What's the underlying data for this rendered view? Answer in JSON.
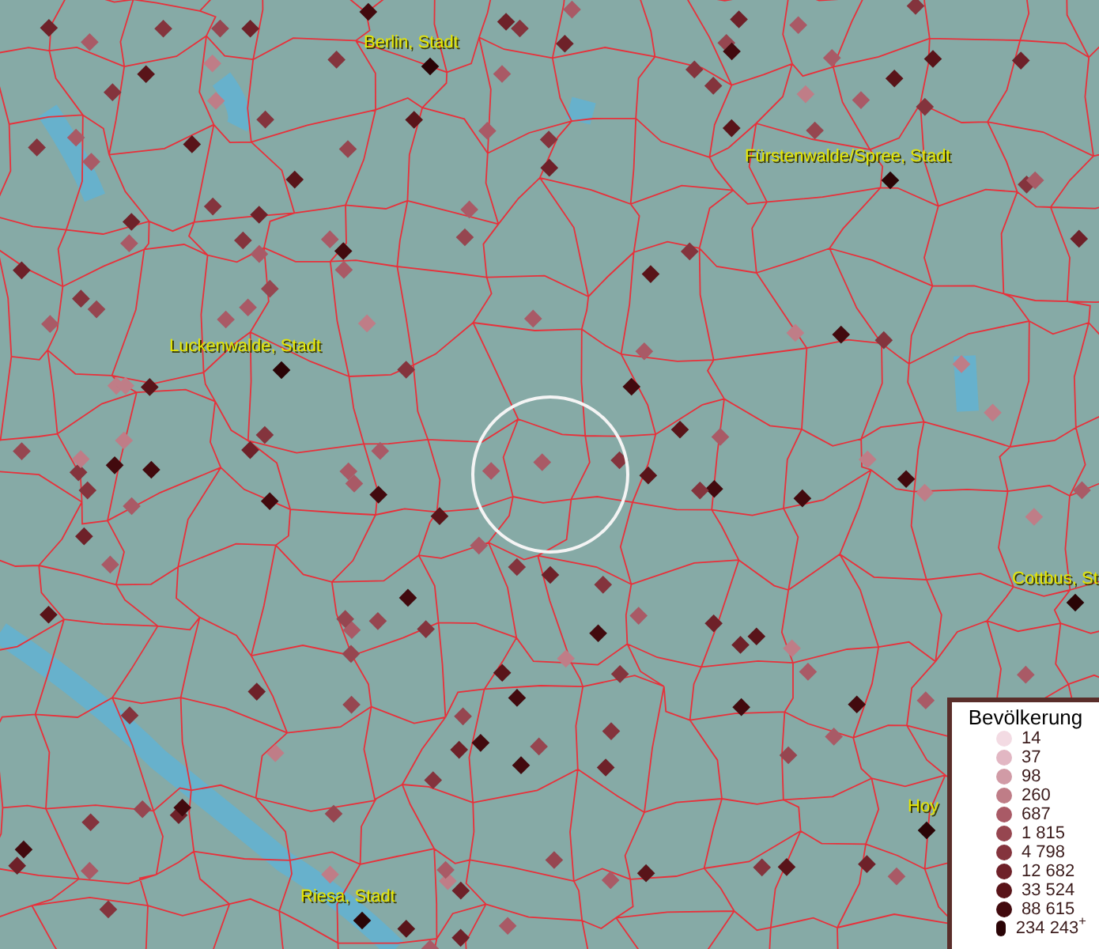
{
  "map": {
    "cities": [
      {
        "name": "Berlin, Stadt"
      },
      {
        "name": "Fürstenwalde/Spree, Stadt"
      },
      {
        "name": "Luckenwalde, Stadt"
      },
      {
        "name": "Cottbus, St"
      },
      {
        "name": "Hoy"
      },
      {
        "name": "Riesa, Stadt"
      }
    ]
  },
  "legend": {
    "title": "Bevölkerung",
    "items": [
      {
        "label": "14",
        "color": "#f3dbe3"
      },
      {
        "label": "37",
        "color": "#e2b7c3"
      },
      {
        "label": "98",
        "color": "#d19ba6"
      },
      {
        "label": "260",
        "color": "#bf7d87"
      },
      {
        "label": "687",
        "color": "#a95a66"
      },
      {
        "label": "1 815",
        "color": "#964650"
      },
      {
        "label": "4 798",
        "color": "#84343d"
      },
      {
        "label": "12 682",
        "color": "#6e2129"
      },
      {
        "label": "33 524",
        "color": "#591419"
      },
      {
        "label": "88 615",
        "color": "#420a0e"
      },
      {
        "label": "234 243$^{+}$",
        "color": "#2a0406"
      }
    ]
  }
}
